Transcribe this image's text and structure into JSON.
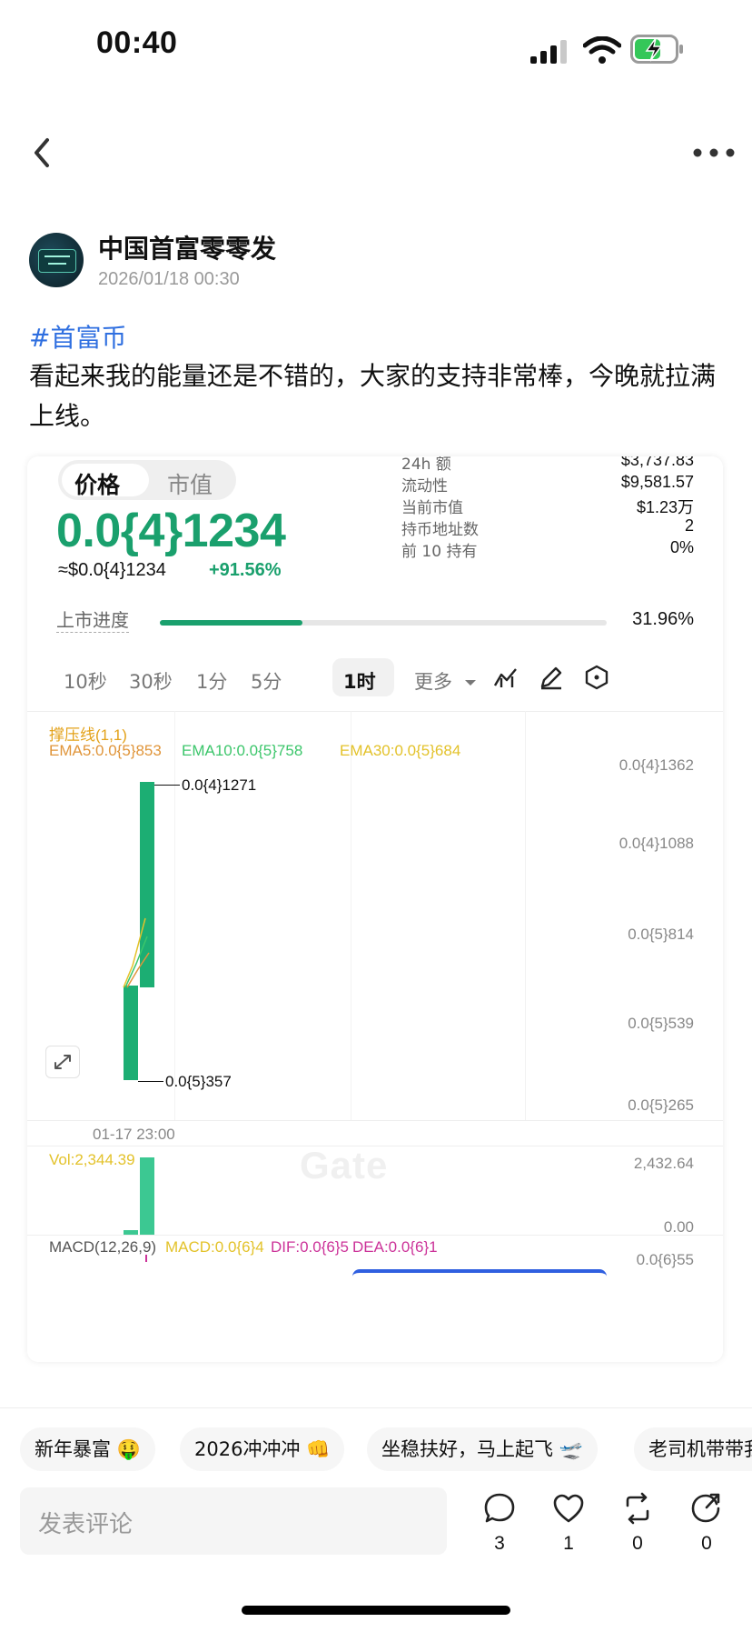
{
  "status_bar": {
    "time": "00:40"
  },
  "post": {
    "author": "中国首富零零发",
    "timestamp": "2026/01/18 00:30",
    "hashtag": "#首富币",
    "text": "看起来我的能量还是不错的，大家的支持非常棒，今晚就拉满上线。"
  },
  "token_card": {
    "tabs": [
      "价格",
      "市值"
    ],
    "price": "0.0{4}1234",
    "usd_price": "≈$0.0{4}1234",
    "change": "+91.56%",
    "stats": [
      {
        "label": "24h 额",
        "value": "$3,737.83"
      },
      {
        "label": "流动性",
        "value": "$9,581.57"
      },
      {
        "label": "当前市值",
        "value": "$1.23万"
      },
      {
        "label": "持币地址数",
        "value": "2"
      },
      {
        "label": "前 10 持有",
        "value": "0%"
      }
    ],
    "listing_progress": {
      "label": "上市进度",
      "value": 0.3196,
      "text": "31.96%"
    },
    "timeframes": [
      "10秒",
      "30秒",
      "1分",
      "5分",
      "1时",
      "更多"
    ],
    "active_timeframe": "1时",
    "colors": {
      "up": "#1aa06d",
      "ema5": "#e0953a",
      "ema10": "#3cc66b",
      "ema30": "#e3c22a",
      "vol": "#e3c22a",
      "macd_dif": "#cc3399"
    }
  },
  "chart_data": [
    {
      "type": "candlestick",
      "legend": {
        "support": "撑压线(1,1)",
        "ema5": "EMA5:0.0{5}853",
        "ema10": "EMA10:0.0{5}758",
        "ema30": "EMA30:0.0{5}684"
      },
      "y_ticks": [
        "0.0{4}1362",
        "0.0{4}1088",
        "0.0{5}814",
        "0.0{5}539",
        "0.0{5}265"
      ],
      "x_label": "01-17 23:00",
      "annotations": {
        "high": "0.0{4}1271",
        "low": "0.0{5}357"
      },
      "watermark": "Gate",
      "candles": [
        {
          "open": 3.57e-06,
          "close": 6.4e-06,
          "high": 6.4e-06,
          "low": 3.57e-06
        },
        {
          "open": 6.4e-06,
          "close": 1.271e-05,
          "high": 1.271e-05,
          "low": 6.4e-06
        }
      ]
    },
    {
      "type": "bar",
      "title": "Vol:2,344.39",
      "y_ticks": [
        "2,432.64",
        "0.00"
      ],
      "values": [
        150,
        2344.39
      ]
    },
    {
      "type": "line",
      "legend": {
        "params": "MACD(12,26,9)",
        "macd": "MACD:0.0{6}4",
        "dif": "DIF:0.0{6}5",
        "dea": "DEA:0.0{6}1"
      },
      "y_ticks": [
        "0.0{6}55"
      ]
    }
  ],
  "quick_replies": [
    "新年暴富 🤑",
    "2026冲冲冲 👊",
    "坐稳扶好，马上起飞 🛫",
    "老司机带带我"
  ],
  "comment": {
    "placeholder": "发表评论"
  },
  "actions": [
    {
      "name": "comment",
      "count": "3"
    },
    {
      "name": "like",
      "count": "1"
    },
    {
      "name": "repost",
      "count": "0"
    },
    {
      "name": "share",
      "count": "0"
    }
  ]
}
